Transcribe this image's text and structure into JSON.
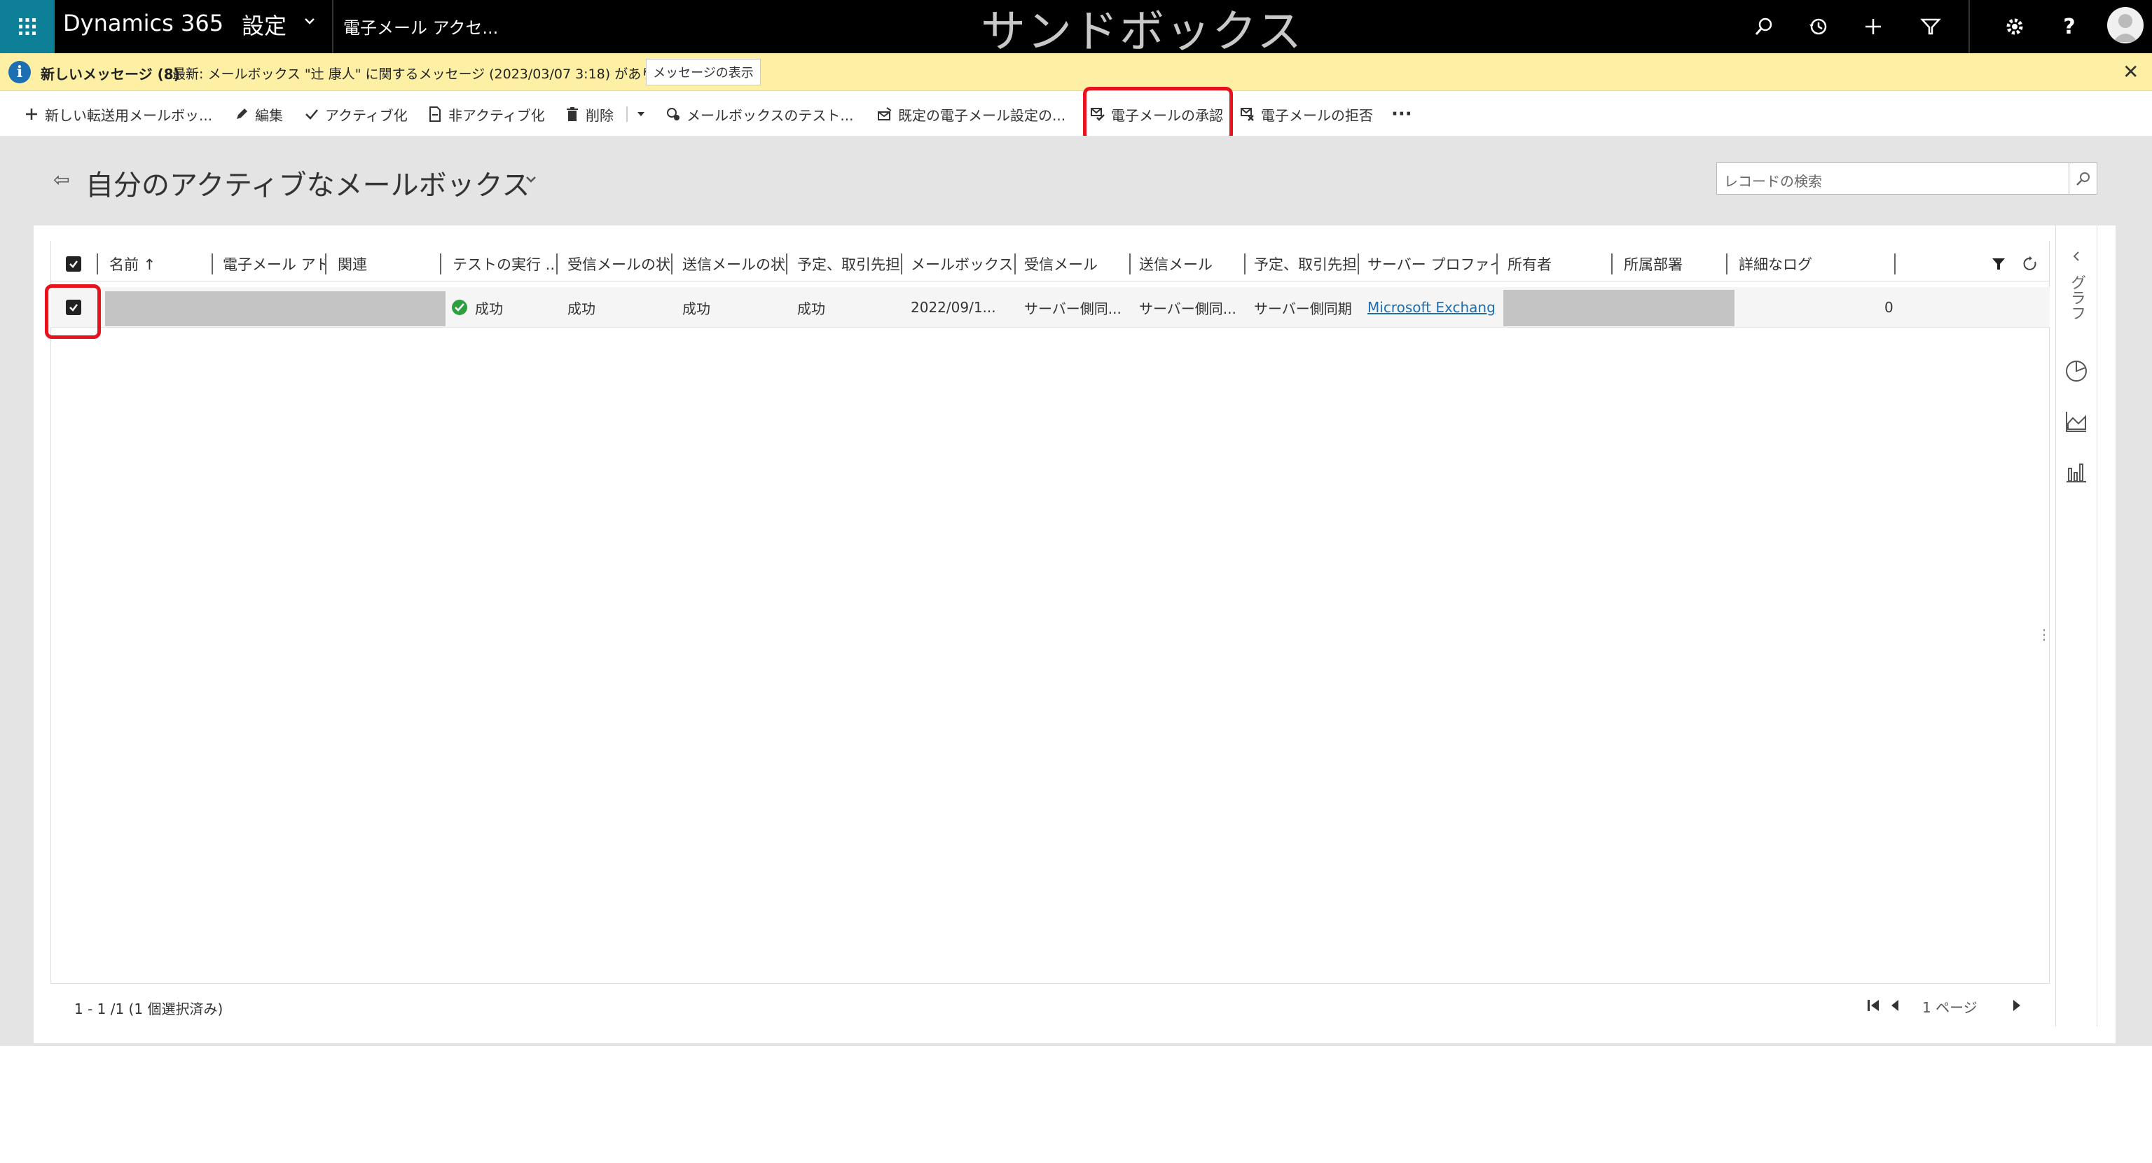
{
  "topbar": {
    "app_name": "Dynamics 365",
    "area": "設定",
    "entity": "電子メール アクセ...",
    "environment_banner": "サンドボックス",
    "icons": [
      "search-icon",
      "history-icon",
      "plus-icon",
      "filter-icon",
      "gear-icon",
      "help-icon",
      "avatar"
    ]
  },
  "notification": {
    "title": "新しいメッセージ (8)",
    "text": "最新: メールボックス \"辻 康人\" に関するメッセージ (2023/03/07 3:18) があります。",
    "button": "メッセージの表示",
    "bg_color": "#fdf0a5"
  },
  "commands": {
    "new": "新しい転送用メールボッ...",
    "edit": "編集",
    "activate": "アクティブ化",
    "deactivate": "非アクティブ化",
    "delete": "削除",
    "test_mailbox": "メールボックスのテスト...",
    "apply_default": "既定の電子メール設定の...",
    "approve_email": "電子メールの承認",
    "reject_email": "電子メールの拒否",
    "more": "···"
  },
  "view": {
    "title": "自分のアクティブなメールボックス",
    "search_placeholder": "レコードの検索"
  },
  "grid": {
    "headers": {
      "name": "名前 ↑",
      "email_address": "電子メール アド",
      "related": "関連",
      "test_exec": "テストの実行 ...",
      "incoming_status": "受信メールの状",
      "outgoing_status": "送信メールの状",
      "appointments": "予定、取引先担",
      "mailbox": "メールボックス",
      "incoming": "受信メール",
      "outgoing": "送信メール",
      "appt_sync": "予定、取引先担",
      "server_profile": "サーバー プロファイ",
      "owner": "所有者",
      "business_unit": "所属部署",
      "detailed_log": "詳細なログ"
    },
    "row": {
      "test_result": "成功",
      "incoming_status": "成功",
      "outgoing_status": "成功",
      "appointments": "成功",
      "mailbox_date": "2022/09/1...",
      "incoming": "サーバー側同...",
      "outgoing": "サーバー側同...",
      "appt_sync": "サーバー側同期",
      "server_profile": "Microsoft Exchang",
      "detailed_log": "0"
    }
  },
  "right_panel": {
    "label": "グラフ"
  },
  "footer": {
    "status": "1 - 1 /1 (1 個選択済み)",
    "page": "1 ページ"
  },
  "colors": {
    "accent": "#0d7f96",
    "highlight": "#e8121e",
    "success": "#2e9f3e",
    "link": "#1d6fb4"
  }
}
